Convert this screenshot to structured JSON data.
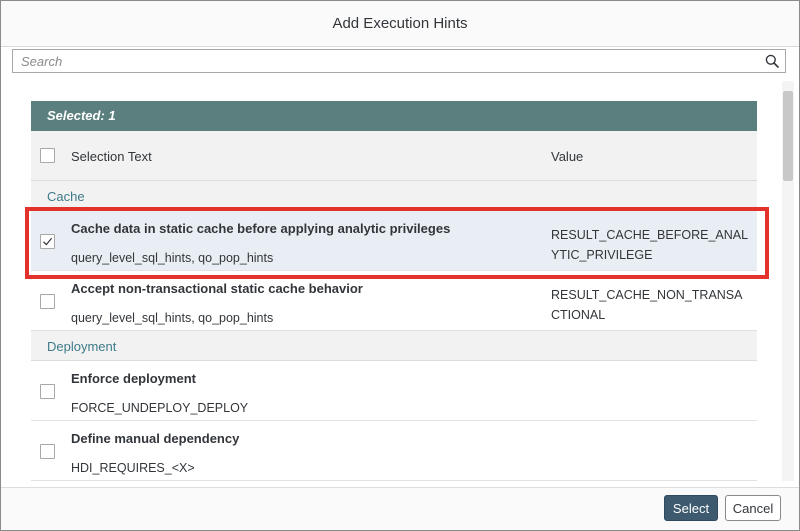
{
  "dialog": {
    "title": "Add Execution Hints"
  },
  "search": {
    "placeholder": "Search",
    "icon": "search-icon"
  },
  "selection": {
    "label": "Selected: 1",
    "bar_color": "#5a7f7e"
  },
  "columns": {
    "selection_text": "Selection Text",
    "value": "Value"
  },
  "groups": [
    {
      "label": "Cache",
      "items": [
        {
          "title": "Cache data in static cache before applying analytic privileges",
          "subtitle": "query_level_sql_hints, qo_pop_hints",
          "value": "RESULT_CACHE_BEFORE_ANALYTIC_PRIVILEGE",
          "checked": true
        },
        {
          "title": "Accept non-transactional static cache behavior",
          "subtitle": "query_level_sql_hints, qo_pop_hints",
          "value": "RESULT_CACHE_NON_TRANSACTIONAL",
          "checked": false
        }
      ]
    },
    {
      "label": "Deployment",
      "items": [
        {
          "title": "Enforce deployment",
          "subtitle": "FORCE_UNDEPLOY_DEPLOY",
          "value": "",
          "checked": false
        },
        {
          "title": "Define manual dependency",
          "subtitle": "HDI_REQUIRES_<X>",
          "value": "",
          "checked": false
        }
      ]
    }
  ],
  "footer": {
    "select_label": "Select",
    "cancel_label": "Cancel"
  },
  "colors": {
    "highlight": "#e3322c",
    "group_text": "#3e7a8a",
    "primary_button": "#3d5a6e"
  }
}
